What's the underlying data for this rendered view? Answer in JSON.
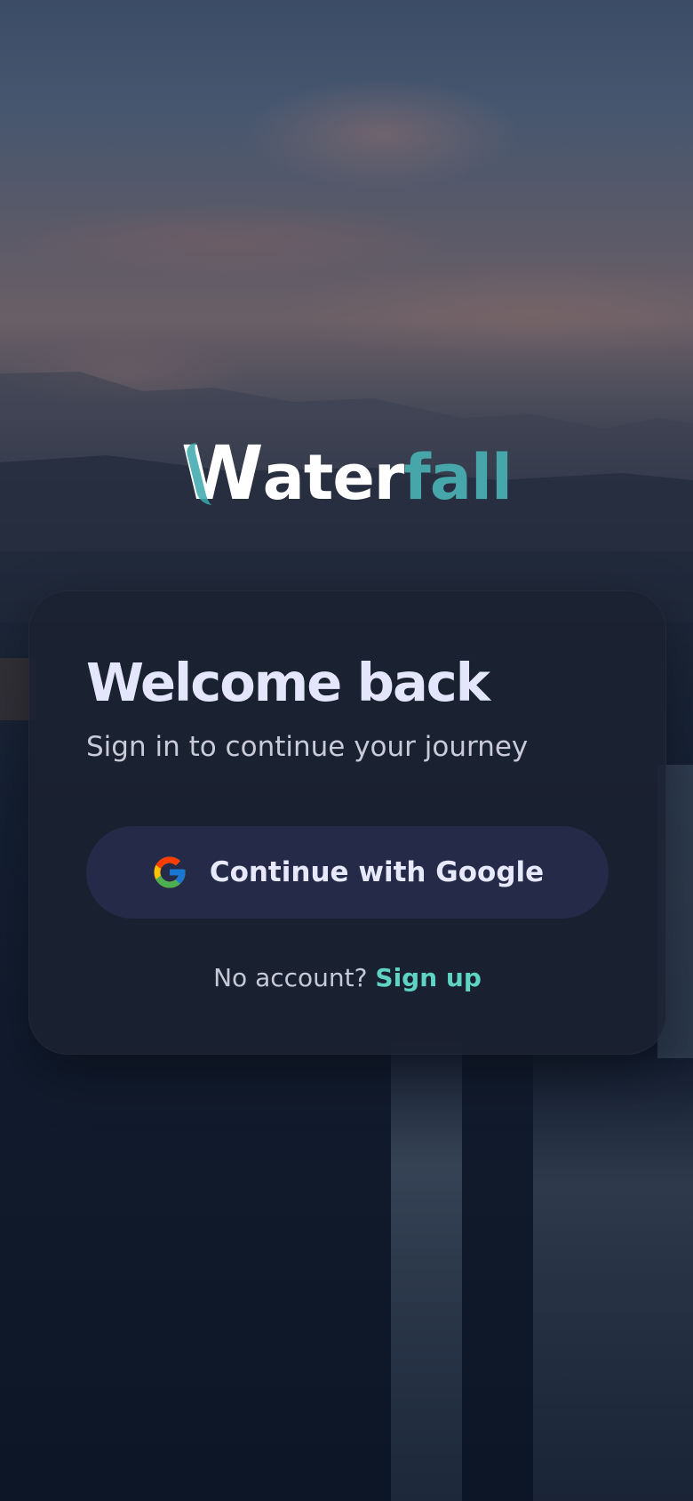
{
  "app": {
    "logo": {
      "part1": "W",
      "part2": "ater",
      "part3": "fall"
    }
  },
  "card": {
    "title": "Welcome back",
    "subtitle": "Sign in to continue your journey",
    "google_button": {
      "label": "Continue with Google",
      "icon": "google-g-icon"
    },
    "signup": {
      "prompt": "No account?",
      "link_label": "Sign up"
    }
  },
  "colors": {
    "accent_teal": "#47a6aa",
    "link_teal": "#5fd3c4",
    "button_bg": "#242a47",
    "card_bg": "#1b2130"
  }
}
